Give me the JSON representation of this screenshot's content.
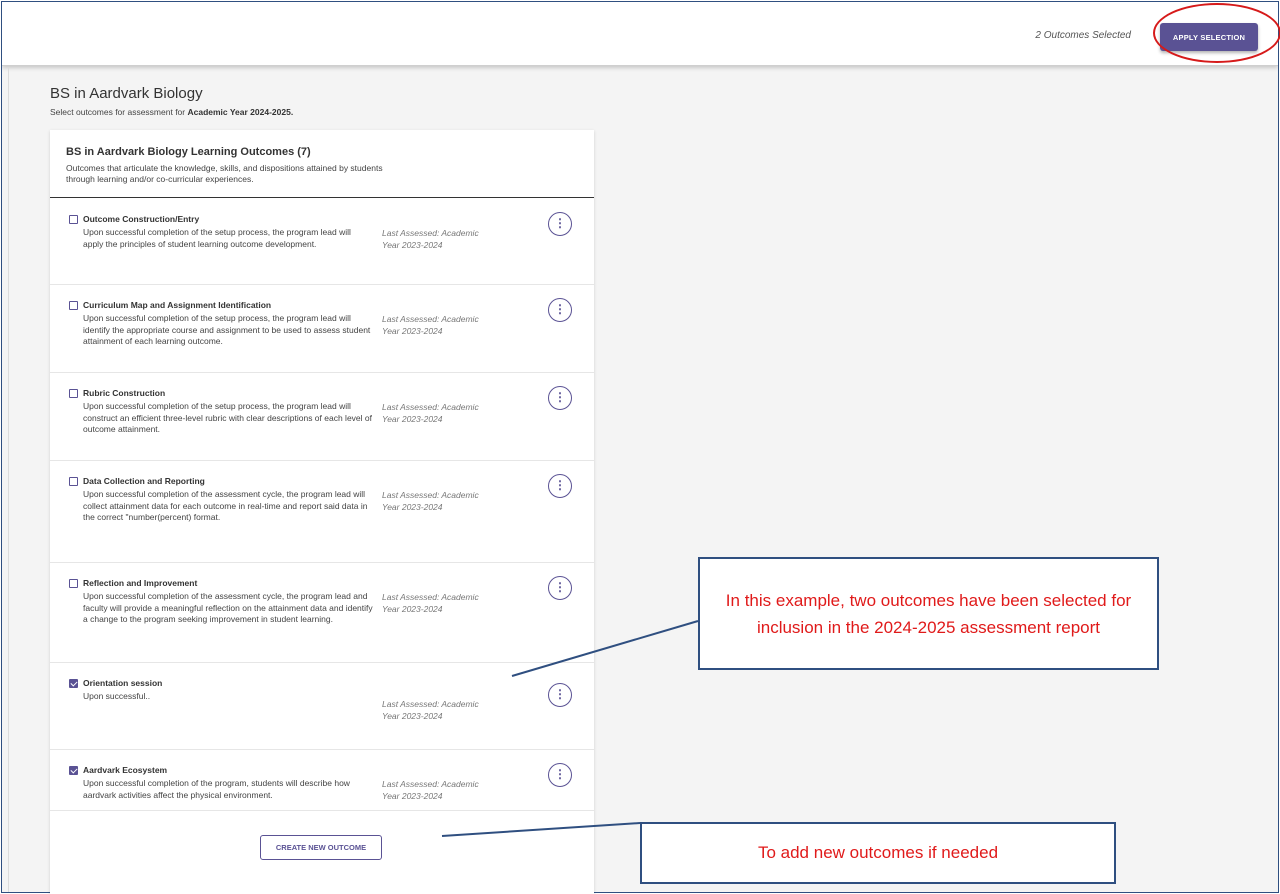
{
  "header": {
    "selected_count": "2 Outcomes Selected",
    "apply_label": "APPLY SELECTION"
  },
  "program": {
    "title": "BS in Aardvark Biology",
    "subtitle_prefix": "Select outcomes for assessment for ",
    "subtitle_year": "Academic Year 2024-2025."
  },
  "card": {
    "title": "BS in Aardvark Biology Learning Outcomes (7)",
    "description": "Outcomes that articulate the knowledge, skills, and dispositions attained by students through learning and/or co-curricular experiences."
  },
  "outcomes": [
    {
      "title": "Outcome Construction/Entry",
      "description": "Upon successful completion of the setup process, the program lead will apply the principles of student learning outcome development.",
      "last_assessed": "Last Assessed: Academic Year 2023-2024",
      "checked": false
    },
    {
      "title": "Curriculum Map and Assignment Identification",
      "description": "Upon successful completion of the setup process, the program lead will identify the appropriate course and assignment to be used to assess student attainment of each learning outcome.",
      "last_assessed": "Last Assessed: Academic Year 2023-2024",
      "checked": false
    },
    {
      "title": "Rubric Construction",
      "description": "Upon successful completion of the setup process, the program lead will construct an efficient three-level rubric with clear descriptions of each level of outcome attainment.",
      "last_assessed": "Last Assessed: Academic Year 2023-2024",
      "checked": false
    },
    {
      "title": "Data Collection and Reporting",
      "description": "Upon successful completion of the assessment cycle, the program lead will collect attainment data for each outcome in real-time and report said data in the correct \"number(percent) format.",
      "last_assessed": "Last Assessed: Academic Year 2023-2024",
      "checked": false
    },
    {
      "title": "Reflection and Improvement",
      "description": "Upon successful completion of the assessment cycle, the program lead and faculty will provide a meaningful reflection on the attainment data and identify a change to the program seeking improvement in student learning.",
      "last_assessed": "Last Assessed: Academic Year 2023-2024",
      "checked": false
    },
    {
      "title": "Orientation session",
      "description": "Upon successful..",
      "last_assessed": "Last Assessed: Academic Year 2023-2024",
      "checked": true
    },
    {
      "title": "Aardvark Ecosystem",
      "description": "Upon successful completion of the program, students will describe how aardvark activities affect the physical environment.",
      "last_assessed": "Last Assessed: Academic Year 2023-2024",
      "checked": true
    }
  ],
  "create_label": "CREATE NEW OUTCOME",
  "kebab_icon": "⋮",
  "callouts": {
    "selection_note": "In this example, two outcomes have been selected for inclusion in the 2024-2025 assessment report",
    "create_note": "To add new outcomes if needed"
  },
  "colors": {
    "accent": "#5a5294",
    "annotation_red": "#e01a1a",
    "annotation_border": "#2f4f80"
  }
}
